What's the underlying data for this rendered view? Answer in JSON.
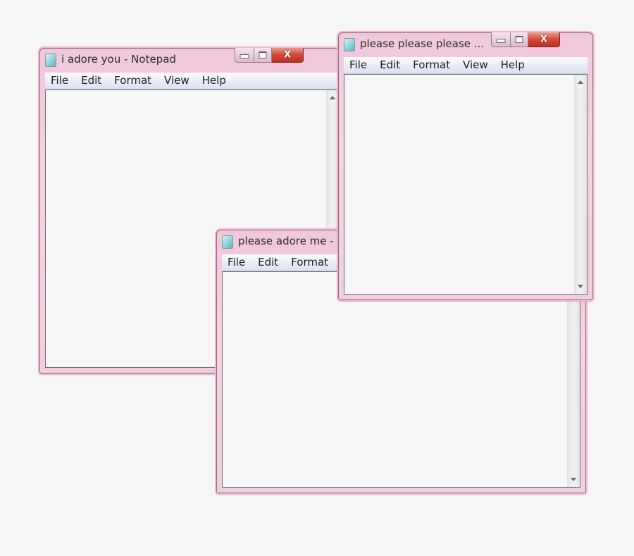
{
  "windows": [
    {
      "id": "back",
      "title": "i adore you - Notepad",
      "menu": [
        "File",
        "Edit",
        "Format",
        "View",
        "Help"
      ],
      "icon": "notepad-icon",
      "content": ""
    },
    {
      "id": "middle",
      "title": "please adore me -",
      "menu": [
        "File",
        "Edit",
        "Format"
      ],
      "icon": "notepad-icon",
      "content": ""
    },
    {
      "id": "front",
      "title": "please please please ...",
      "menu": [
        "File",
        "Edit",
        "Format",
        "View",
        "Help"
      ],
      "icon": "notepad-icon",
      "content": ""
    }
  ],
  "caption_buttons": {
    "minimize": "minimize",
    "maximize": "maximize",
    "close": "X"
  },
  "colors": {
    "frame_pink": "#f2c7db",
    "close_red": "#d4483b",
    "menubar": "#e9ecf6",
    "editor_bg": "#f7f7f7",
    "desktop": "#f6f6f6"
  }
}
